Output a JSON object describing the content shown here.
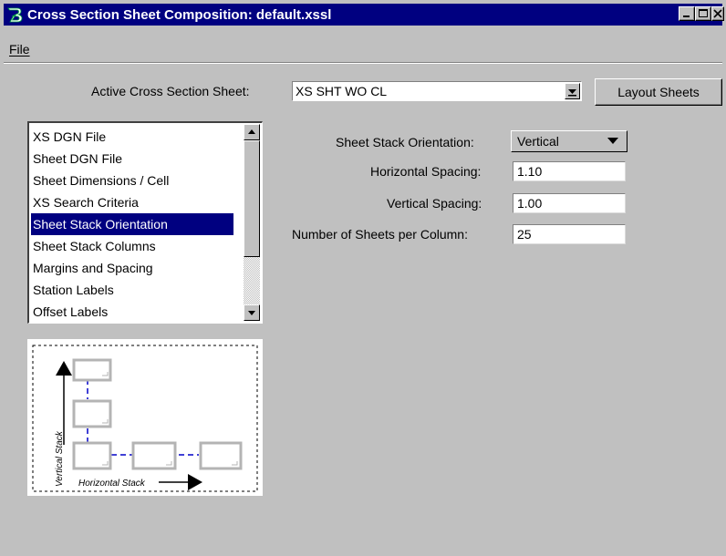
{
  "window": {
    "title": "Cross Section Sheet Composition: default.xssl",
    "app_icon": "bentley-b-icon",
    "controls": [
      "minimize-icon",
      "maximize-icon",
      "close-icon"
    ]
  },
  "menu": {
    "file_label": "File"
  },
  "active_sheet": {
    "label": "Active Cross Section Sheet:",
    "value": "XS SHT WO CL",
    "layout_button": "Layout Sheets"
  },
  "categories": {
    "items": [
      "XS DGN File",
      "Sheet DGN File",
      "Sheet Dimensions / Cell",
      "XS Search Criteria",
      "Sheet Stack Orientation",
      "Sheet Stack Columns",
      "Margins and Spacing",
      "Station Labels",
      "Offset Labels"
    ],
    "selected_index": 4
  },
  "preview": {
    "vertical_label": "Vertical Stack",
    "horizontal_label": "Horizontal Stack"
  },
  "properties": {
    "orientation_label": "Sheet Stack Orientation:",
    "orientation_value": "Vertical",
    "horizontal_spacing_label": "Horizontal Spacing:",
    "horizontal_spacing_value": "1.10",
    "vertical_spacing_label": "Vertical Spacing:",
    "vertical_spacing_value": "1.00",
    "sheets_per_column_label": "Number of Sheets per Column:",
    "sheets_per_column_value": "25"
  },
  "colors": {
    "titlebar": "#000080",
    "selection": "#000080",
    "face": "#c0c0c0",
    "connector": "#0000c8"
  }
}
